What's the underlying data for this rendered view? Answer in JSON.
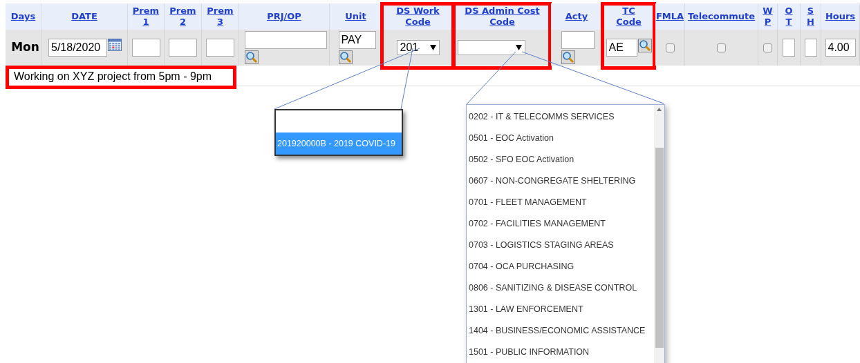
{
  "table": {
    "columns": [
      {
        "label": "Days",
        "highlighted": false
      },
      {
        "label": "DATE",
        "highlighted": false
      },
      {
        "label": "Prem 1",
        "highlighted": false
      },
      {
        "label": "Prem 2",
        "highlighted": false
      },
      {
        "label": "Prem 3",
        "highlighted": false
      },
      {
        "label": "PRJ/OP",
        "highlighted": false
      },
      {
        "label": "Unit",
        "highlighted": false
      },
      {
        "label": "DS Work Code",
        "highlighted": true
      },
      {
        "label": "DS Admin Cost Code",
        "highlighted": true
      },
      {
        "label": "Acty",
        "highlighted": false
      },
      {
        "label": "TC Code",
        "highlighted": true
      },
      {
        "label": "FMLA",
        "highlighted": false
      },
      {
        "label": "Telecommute",
        "highlighted": false
      },
      {
        "label": "W P",
        "highlighted": false
      },
      {
        "label": "O T",
        "highlighted": false
      },
      {
        "label": "S H",
        "highlighted": false
      },
      {
        "label": "Hours",
        "highlighted": false
      }
    ],
    "row": [
      {
        "kind": "day",
        "value": "Mon"
      },
      {
        "kind": "date",
        "value": "5/18/2020"
      },
      {
        "kind": "input"
      },
      {
        "kind": "input"
      },
      {
        "kind": "input"
      },
      {
        "kind": "lookup"
      },
      {
        "kind": "lookup",
        "value": "PAY"
      },
      {
        "kind": "select",
        "value": "201"
      },
      {
        "kind": "select"
      },
      {
        "kind": "lookup"
      },
      {
        "kind": "inline_lookup",
        "value": "AE"
      },
      {
        "kind": "checkbox",
        "checked": false
      },
      {
        "kind": "checkbox",
        "checked": false
      },
      {
        "kind": "checkbox",
        "checked": false
      },
      {
        "kind": "narrow_input"
      },
      {
        "kind": "narrow_input"
      },
      {
        "kind": "input",
        "value": "4.00"
      }
    ]
  },
  "note": {
    "text": "Working on XYZ project from 5pm - 9pm",
    "highlighted": true
  },
  "callouts": [
    {
      "items": [
        {
          "kind": "blank",
          "selected": false
        },
        {
          "kind": "option",
          "label": "201920000B - 2019 COVID-19",
          "selected": true
        }
      ]
    },
    {
      "items": [
        {
          "label": "0202 - IT & TELECOMMS SERVICES",
          "selected": false
        },
        {
          "label": "0501 - EOC Activation",
          "selected": false
        },
        {
          "label": "0502 - SFO EOC Activation",
          "selected": false
        },
        {
          "label": "0607 - NON-CONGREGATE SHELTERING",
          "selected": false
        },
        {
          "label": "0701 - FLEET MANAGEMENT",
          "selected": false
        },
        {
          "label": "0702 - FACILITIES MANAGEMENT",
          "selected": false
        },
        {
          "label": "0703 - LOGISTICS STAGING AREAS",
          "selected": false
        },
        {
          "label": "0704 - OCA PURCHASING",
          "selected": false
        },
        {
          "label": "0806 - SANITIZING & DISEASE CONTROL",
          "selected": false
        },
        {
          "label": "1301 - LAW ENFORCEMENT",
          "selected": false
        },
        {
          "label": "1404 - BUSINESS/ECONOMIC ASSISTANCE",
          "selected": false
        },
        {
          "label": "1501 - PUBLIC INFORMATION",
          "selected": false
        }
      ]
    }
  ]
}
